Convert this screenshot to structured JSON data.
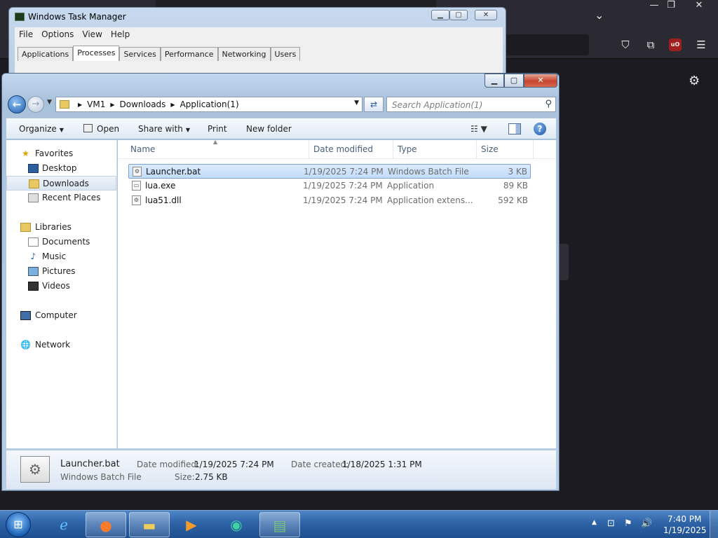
{
  "firefox": {
    "chevron": "⌄",
    "min": "—",
    "max": "❐",
    "close": "✕",
    "ublock_label": "uO",
    "icons": [
      "pocket-icon",
      "extensions-icon",
      "ublock-icon",
      "hamburger-menu-icon",
      "settings-gear-icon"
    ]
  },
  "taskmgr": {
    "title": "Windows Task Manager",
    "menu": [
      "File",
      "Options",
      "View",
      "Help"
    ],
    "tabs": [
      "Applications",
      "Processes",
      "Services",
      "Performance",
      "Networking",
      "Users"
    ],
    "active_tab": "Processes",
    "buttons": {
      "min": "▁",
      "max": "▢",
      "close": "✕"
    }
  },
  "explorer": {
    "caption": {
      "min": "▁",
      "max": "▢",
      "close": "✕"
    },
    "breadcrumb": [
      "VM1",
      "Downloads",
      "Application(1)"
    ],
    "search_placeholder": "Search Application(1)",
    "toolbar": {
      "organize": "Organize",
      "open": "Open",
      "share_with": "Share with",
      "print": "Print",
      "new_folder": "New folder"
    },
    "nav": {
      "favorites": "Favorites",
      "desktop": "Desktop",
      "downloads": "Downloads",
      "recent_places": "Recent Places",
      "libraries": "Libraries",
      "documents": "Documents",
      "music": "Music",
      "pictures": "Pictures",
      "videos": "Videos",
      "computer": "Computer",
      "network": "Network"
    },
    "columns": {
      "name": "Name",
      "date_modified": "Date modified",
      "type": "Type",
      "size": "Size"
    },
    "files": [
      {
        "name": "Launcher.bat",
        "date": "1/19/2025 7:24 PM",
        "type": "Windows Batch File",
        "size": "3 KB",
        "selected": true
      },
      {
        "name": "lua.exe",
        "date": "1/19/2025 7:24 PM",
        "type": "Application",
        "size": "89 KB",
        "selected": false
      },
      {
        "name": "lua51.dll",
        "date": "1/19/2025 7:24 PM",
        "type": "Application extens...",
        "size": "592 KB",
        "selected": false
      }
    ],
    "details": {
      "name": "Launcher.bat",
      "type": "Windows Batch File",
      "date_modified_label": "Date modified:",
      "date_modified": "1/19/2025 7:24 PM",
      "date_created_label": "Date created:",
      "date_created": "1/18/2025 1:31 PM",
      "size_label": "Size:",
      "size": "2.75 KB"
    }
  },
  "taskbar": {
    "time": "7:40 PM",
    "date": "1/19/2025",
    "pinned": [
      "internet-explorer",
      "firefox",
      "windows-explorer",
      "media-player",
      "edge",
      "task-manager"
    ]
  },
  "colors": {
    "selection": "#c1dcfc",
    "taskbar": "#2d63a7",
    "close_button": "#c7442e",
    "firefox_bg": "#1c1b22"
  }
}
